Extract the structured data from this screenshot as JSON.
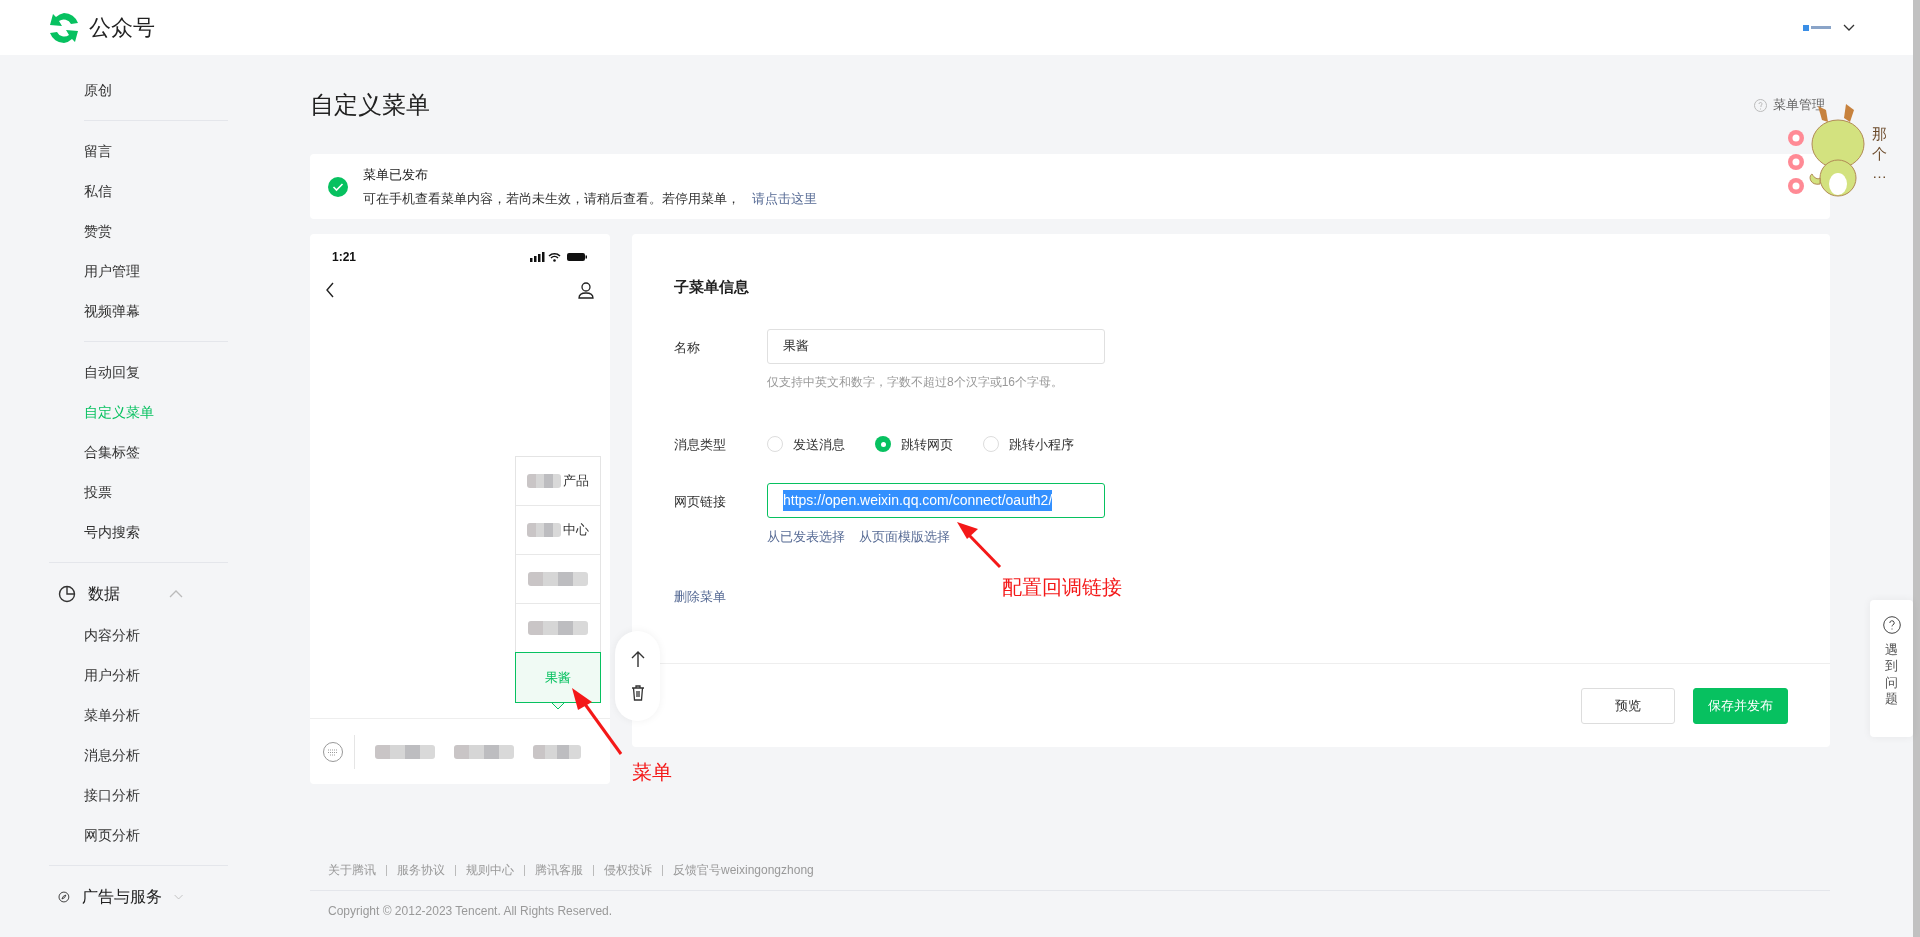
{
  "header": {
    "app_name": "公众号"
  },
  "sidebar": {
    "groups": [
      {
        "items": [
          {
            "label": "原创",
            "selected": false
          }
        ]
      },
      {
        "items": [
          {
            "label": "留言",
            "selected": false
          },
          {
            "label": "私信",
            "selected": false
          },
          {
            "label": "赞赏",
            "selected": false
          },
          {
            "label": "用户管理",
            "selected": false
          },
          {
            "label": "视频弹幕",
            "selected": false
          }
        ]
      },
      {
        "items": [
          {
            "label": "自动回复",
            "selected": false
          },
          {
            "label": "自定义菜单",
            "selected": true
          },
          {
            "label": "合集标签",
            "selected": false
          },
          {
            "label": "投票",
            "selected": false
          },
          {
            "label": "号内搜索",
            "selected": false
          }
        ]
      },
      {
        "section": "数据",
        "expanded": true,
        "items": [
          {
            "label": "内容分析",
            "selected": false
          },
          {
            "label": "用户分析",
            "selected": false
          },
          {
            "label": "菜单分析",
            "selected": false
          },
          {
            "label": "消息分析",
            "selected": false
          },
          {
            "label": "接口分析",
            "selected": false
          },
          {
            "label": "网页分析",
            "selected": false
          }
        ]
      },
      {
        "section": "广告与服务",
        "expanded": false
      }
    ]
  },
  "page": {
    "title": "自定义菜单",
    "help_link": "菜单管理"
  },
  "notice": {
    "title": "菜单已发布",
    "message": "可在手机查看菜单内容，若尚未生效，请稍后查看。若停用菜单，",
    "link": "请点击这里"
  },
  "phone": {
    "time": "1:21",
    "submenu": [
      {
        "label": "产品",
        "redacted": true,
        "selected": false
      },
      {
        "label": "中心",
        "redacted": true,
        "selected": false
      },
      {
        "redacted": true,
        "selected": false
      },
      {
        "redacted": true,
        "selected": false
      },
      {
        "label": "果酱",
        "redacted": false,
        "selected": true
      }
    ]
  },
  "form": {
    "title": "子菜单信息",
    "name_label": "名称",
    "name_value": "果酱",
    "name_hint": "仅支持中英文和数字，字数不超过8个汉字或16个字母。",
    "type_label": "消息类型",
    "types": [
      {
        "label": "发送消息",
        "selected": false
      },
      {
        "label": "跳转网页",
        "selected": true
      },
      {
        "label": "跳转小程序",
        "selected": false
      }
    ],
    "url_label": "网页链接",
    "url_value": "https://open.weixin.qq.com/connect/oauth2/",
    "url_text_selected": true,
    "url_links": [
      "从已发表选择",
      "从页面模版选择"
    ],
    "delete": "删除菜单",
    "buttons": [
      {
        "label": "预览",
        "kind": "default"
      },
      {
        "label": "保存并发布",
        "kind": "primary"
      }
    ]
  },
  "annotations": [
    {
      "text": "配置回调链接"
    },
    {
      "text": "菜单"
    }
  ],
  "footer": {
    "links": [
      "关于腾讯",
      "服务协议",
      "规则中心",
      "腾讯客服",
      "侵权投诉",
      "反馈官号weixingongzhong"
    ],
    "copyright": "Copyright © 2012-2023 Tencent. All Rights Reserved."
  },
  "help_widget": {
    "label": "遇到问题"
  },
  "sticker": {
    "text": "那个…"
  }
}
